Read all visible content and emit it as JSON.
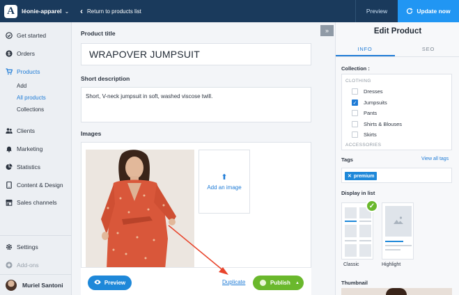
{
  "topbar": {
    "store_name": "léonie-apparel",
    "back_label": "Return to products list",
    "preview_label": "Preview",
    "update_label": "Update now"
  },
  "sidebar": {
    "items": [
      {
        "label": "Get started",
        "icon": "check-circle-icon"
      },
      {
        "label": "Orders",
        "icon": "dollar-circle-icon"
      },
      {
        "label": "Products",
        "icon": "cart-icon"
      },
      {
        "label": "Clients",
        "icon": "users-icon"
      },
      {
        "label": "Marketing",
        "icon": "bell-icon"
      },
      {
        "label": "Statistics",
        "icon": "pie-chart-icon"
      },
      {
        "label": "Content & Design",
        "icon": "tablet-icon"
      },
      {
        "label": "Sales channels",
        "icon": "store-icon"
      },
      {
        "label": "Settings",
        "icon": "gear-icon"
      },
      {
        "label": "Add-ons",
        "icon": "plus-circle-icon"
      }
    ],
    "sub_items": [
      "Add",
      "All products",
      "Collections"
    ],
    "user_name": "Muriel Santoni"
  },
  "main": {
    "title_label": "Product title",
    "title_value": "WRAPOVER JUMPSUIT",
    "desc_label": "Short description",
    "desc_value": "Short, V-neck jumpsuit in soft, washed viscose twill.",
    "images_label": "Images",
    "add_image_label": "Add an image"
  },
  "actions": {
    "preview_label": "Preview",
    "duplicate_label": "Duplicate",
    "publish_label": "Publish"
  },
  "panel": {
    "title": "Edit Product",
    "tabs": [
      "INFO",
      "SEO"
    ],
    "collection_label": "Collection :",
    "groups": [
      "CLOTHING",
      "ACCESSORIES"
    ],
    "collections": [
      {
        "label": "Dresses",
        "checked": false
      },
      {
        "label": "Jumpsuits",
        "checked": true
      },
      {
        "label": "Pants",
        "checked": false
      },
      {
        "label": "Shirts & Blouses",
        "checked": false
      },
      {
        "label": "Skirts",
        "checked": false
      }
    ],
    "tags_label": "Tags",
    "view_all_tags": "View all tags",
    "tag": "premium",
    "display_label": "Display in list",
    "layouts": [
      "Classic",
      "Highlight"
    ],
    "thumbnail_label": "Thumbnail"
  },
  "colors": {
    "topbar": "#1a3a5c",
    "accent": "#1e88d9",
    "publish": "#6ab82c",
    "annotation_arrow": "#e8442b"
  }
}
